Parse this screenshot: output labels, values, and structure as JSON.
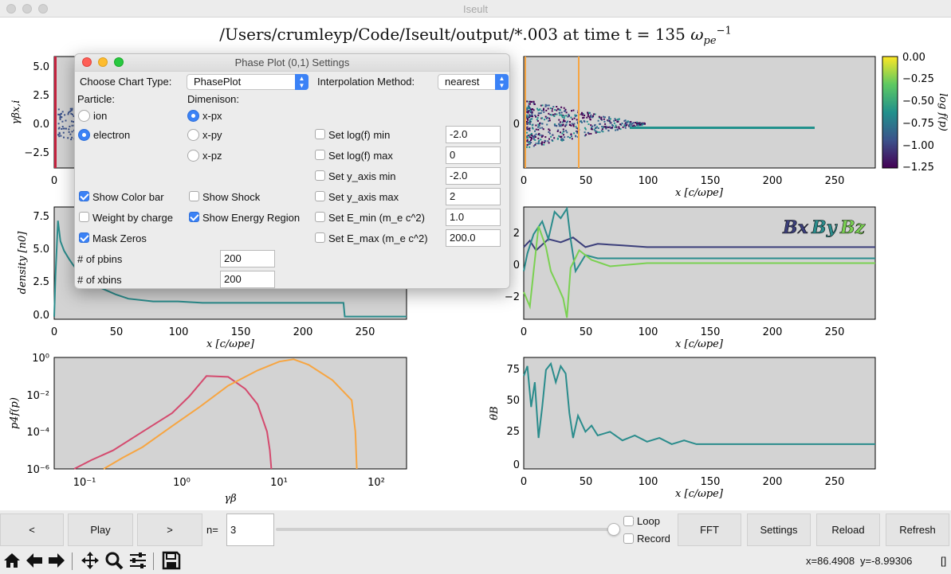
{
  "window": {
    "title": "Iseult"
  },
  "figure": {
    "title_prefix": "/Users/crumleyp/Code/Iseult/output/*.003 at time t = 135 ",
    "title_omega": "ω",
    "title_sub": "pe",
    "title_sup": "−1"
  },
  "panels": {
    "phase_ion": {
      "ylabel": "γβx,i",
      "yticks": [
        "5.0",
        "2.5",
        "0.0",
        "−2.5"
      ],
      "xticks": [
        "0"
      ]
    },
    "phase_electron": {
      "xlabel": "x [c/ωpe]",
      "yticks": [
        "0"
      ],
      "xticks": [
        "0",
        "50",
        "100",
        "150",
        "200",
        "250"
      ],
      "colorbar_label": "log f(p)",
      "colorbar_ticks": [
        "0.00",
        "−0.25",
        "−0.50",
        "−0.75",
        "−1.00",
        "−1.25"
      ]
    },
    "density": {
      "ylabel": "density [n0]",
      "xlabel": "x [c/ωpe]",
      "yticks": [
        "7.5",
        "5.0",
        "2.5",
        "0.0"
      ],
      "xticks": [
        "0",
        "50",
        "100",
        "150",
        "200",
        "250"
      ]
    },
    "bfield": {
      "xlabel": "x [c/ωpe]",
      "yticks": [
        "2",
        "0",
        "−2"
      ],
      "xticks": [
        "0",
        "50",
        "100",
        "150",
        "200",
        "250"
      ],
      "legend": [
        "Bx",
        "By",
        "Bz"
      ]
    },
    "spectrum": {
      "ylabel": "p4f(p)",
      "xlabel": "γβ",
      "yticks": [
        "10⁰",
        "10⁻²",
        "10⁻⁴",
        "10⁻⁶"
      ],
      "xticks": [
        "10⁻¹",
        "10⁰",
        "10¹",
        "10²"
      ]
    },
    "theta": {
      "ylabel": "θB",
      "xlabel": "x [c/ωpe]",
      "yticks": [
        "75",
        "50",
        "25",
        "0"
      ],
      "xticks": [
        "0",
        "50",
        "100",
        "150",
        "200",
        "250"
      ]
    }
  },
  "chart_data": [
    {
      "type": "line",
      "panel": "density",
      "ylabel": "density [n0]",
      "xlabel": "x [c/ωpe]",
      "xlim": [
        0,
        285
      ],
      "ylim": [
        -0.2,
        8.0
      ],
      "series": [
        {
          "color": "#2a8c8c",
          "x": [
            0,
            1,
            3,
            5,
            8,
            12,
            15,
            20,
            25,
            30,
            40,
            50,
            60,
            80,
            100,
            120,
            150,
            180,
            200,
            220,
            234,
            235,
            240,
            285
          ],
          "y": [
            0,
            3.0,
            7.0,
            5.5,
            4.8,
            4.2,
            3.8,
            3.2,
            2.8,
            2.4,
            2.0,
            1.6,
            1.3,
            1.1,
            1.1,
            1.0,
            1.0,
            1.0,
            1.0,
            1.0,
            1.0,
            0.0,
            0.0,
            0.0
          ]
        }
      ]
    },
    {
      "type": "line",
      "panel": "bfield",
      "xlim": [
        0,
        285
      ],
      "ylim": [
        -3.5,
        3.5
      ],
      "series": [
        {
          "name": "Bx",
          "color": "#3b3e7a",
          "x": [
            0,
            5,
            10,
            20,
            30,
            40,
            50,
            60,
            80,
            100,
            285
          ],
          "y": [
            1.0,
            1.4,
            0.8,
            1.5,
            1.3,
            1.6,
            1.0,
            1.2,
            1.1,
            1.0,
            1.0
          ]
        },
        {
          "name": "By",
          "color": "#2a8c8c",
          "x": [
            0,
            3,
            8,
            15,
            20,
            25,
            30,
            35,
            38,
            42,
            50,
            60,
            80,
            100,
            285
          ],
          "y": [
            -0.5,
            0.6,
            1.8,
            2.6,
            1.5,
            3.2,
            2.8,
            3.4,
            1.5,
            -0.5,
            0.5,
            0.3,
            0.3,
            0.3,
            0.3
          ]
        },
        {
          "name": "Bz",
          "color": "#7ad151",
          "x": [
            0,
            5,
            8,
            12,
            18,
            22,
            28,
            32,
            35,
            38,
            45,
            55,
            70,
            100,
            285
          ],
          "y": [
            -1.8,
            -2.7,
            -0.5,
            2.3,
            1.0,
            -0.5,
            -1.5,
            -2.2,
            -3.4,
            -0.3,
            0.8,
            0.2,
            -0.2,
            0.0,
            0.0
          ]
        }
      ]
    },
    {
      "type": "line",
      "panel": "spectrum",
      "xscale": "log",
      "yscale": "log",
      "xlim": [
        0.05,
        200
      ],
      "ylim": [
        1e-06,
        1
      ],
      "series": [
        {
          "color": "#d44a6e",
          "x": [
            0.08,
            0.12,
            0.2,
            0.4,
            0.8,
            1.2,
            1.8,
            3.0,
            4.5,
            6.0,
            7.5,
            8.0,
            8.3
          ],
          "y": [
            1e-06,
            3e-06,
            1e-05,
            0.0001,
            0.001,
            0.008,
            0.1,
            0.09,
            0.02,
            0.003,
            0.0001,
            1e-05,
            1e-06
          ]
        },
        {
          "color": "#f7a541",
          "x": [
            0.16,
            0.25,
            0.4,
            0.8,
            1.5,
            3.0,
            6.0,
            10,
            14,
            20,
            35,
            55,
            60,
            62
          ],
          "y": [
            1e-06,
            4e-06,
            1.5e-05,
            0.0002,
            0.002,
            0.03,
            0.2,
            0.6,
            0.8,
            0.4,
            0.06,
            0.005,
            0.0001,
            1e-06
          ]
        }
      ]
    },
    {
      "type": "line",
      "panel": "theta",
      "xlim": [
        0,
        285
      ],
      "ylim": [
        -5,
        85
      ],
      "series": [
        {
          "color": "#2a8c8c",
          "x": [
            0,
            3,
            6,
            9,
            12,
            15,
            18,
            22,
            26,
            30,
            34,
            37,
            40,
            44,
            50,
            55,
            60,
            70,
            80,
            90,
            100,
            110,
            120,
            130,
            140,
            285
          ],
          "y": [
            70,
            78,
            45,
            65,
            20,
            45,
            75,
            80,
            65,
            78,
            72,
            40,
            20,
            38,
            25,
            30,
            22,
            25,
            18,
            22,
            17,
            20,
            15,
            18,
            15,
            15
          ]
        }
      ]
    }
  ],
  "dialog": {
    "title": "Phase Plot (0,1) Settings",
    "chart_type_label": "Choose Chart Type:",
    "chart_type_value": "PhasePlot",
    "interp_label": "Interpolation Method:",
    "interp_value": "nearest",
    "particle_label": "Particle:",
    "dimension_label": "Dimenison:",
    "particles": [
      "ion",
      "electron"
    ],
    "dimensions": [
      "x-px",
      "x-py",
      "x-pz"
    ],
    "options": {
      "show_colorbar": "Show Color bar",
      "show_shock": "Show Shock",
      "weight_by_charge": "Weight by charge",
      "show_energy_region": "Show Energy Region",
      "mask_zeros": "Mask Zeros"
    },
    "settings": [
      {
        "label": "Set log(f) min",
        "value": "-2.0"
      },
      {
        "label": "Set log(f) max",
        "value": "0"
      },
      {
        "label": "Set y_axis min",
        "value": "-2.0"
      },
      {
        "label": "Set y_axis max",
        "value": "2"
      },
      {
        "label": "Set E_min (m_e c^2)",
        "value": "1.0"
      },
      {
        "label": "Set E_max (m_e c^2)",
        "value": "200.0"
      }
    ],
    "pbins_label": "# of pbins",
    "pbins_value": "200",
    "xbins_label": "# of xbins",
    "xbins_value": "200"
  },
  "controls": {
    "prev": "<",
    "play": "Play",
    "next": ">",
    "n_label": "n=",
    "n_value": "3",
    "loop": "Loop",
    "record": "Record",
    "fft": "FFT",
    "settings": "Settings",
    "reload": "Reload",
    "refresh": "Refresh",
    "slider_fraction": 1.0
  },
  "status": {
    "x": "x=86.4908",
    "y": "y=-8.99306",
    "extra": "[]"
  },
  "toolbar_icons": [
    "home-icon",
    "back-icon",
    "forward-icon",
    "pan-icon",
    "zoom-icon",
    "configure-icon",
    "save-icon"
  ]
}
